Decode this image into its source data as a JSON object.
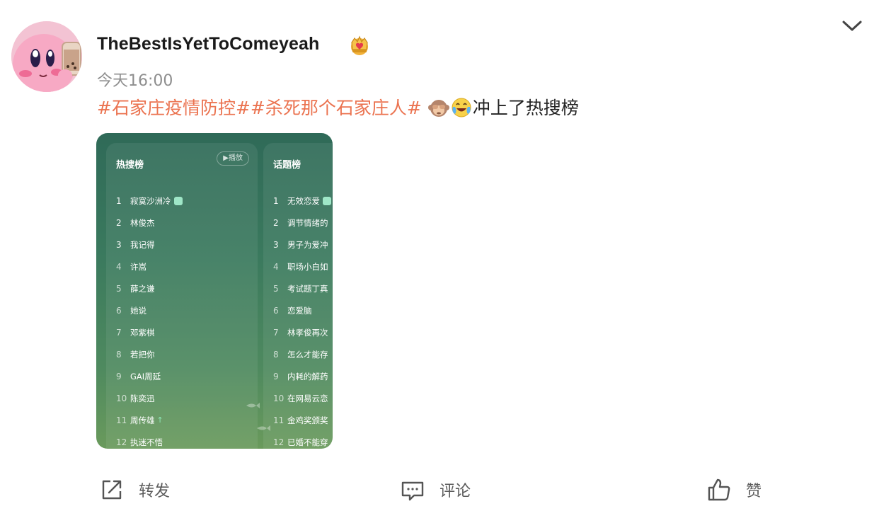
{
  "post": {
    "username": "TheBestIsYetToComeyeah",
    "time": "今天16:00",
    "tag1": "#石家庄疫情防控#",
    "tag2": "#杀死那个石家庄人#",
    "text": "冲上了热搜榜"
  },
  "image": {
    "panel1": {
      "title": "热搜榜",
      "play_label": "▶播放",
      "items": [
        {
          "num": "1",
          "title": "寂寞沙洲冷"
        },
        {
          "num": "2",
          "title": "林俊杰"
        },
        {
          "num": "3",
          "title": "我记得"
        },
        {
          "num": "4",
          "title": "许嵩"
        },
        {
          "num": "5",
          "title": "薛之谦"
        },
        {
          "num": "6",
          "title": "她说"
        },
        {
          "num": "7",
          "title": "邓紫棋"
        },
        {
          "num": "8",
          "title": "若把你"
        },
        {
          "num": "9",
          "title": "GAI周延"
        },
        {
          "num": "10",
          "title": "陈奕迅"
        },
        {
          "num": "11",
          "title": "周传雄"
        },
        {
          "num": "12",
          "title": "执迷不悟"
        }
      ]
    },
    "panel2": {
      "title": "话题榜",
      "items": [
        {
          "num": "1",
          "title": "无效恋爱"
        },
        {
          "num": "2",
          "title": "调节情绪的"
        },
        {
          "num": "3",
          "title": "男子为爱冲"
        },
        {
          "num": "4",
          "title": "职场小白如"
        },
        {
          "num": "5",
          "title": "考试题丁真"
        },
        {
          "num": "6",
          "title": "恋爱脑"
        },
        {
          "num": "7",
          "title": "林孝俊再次"
        },
        {
          "num": "8",
          "title": "怎么才能存"
        },
        {
          "num": "9",
          "title": "内耗的解药"
        },
        {
          "num": "10",
          "title": "在网易云恋"
        },
        {
          "num": "11",
          "title": "金鸡奖颁奖"
        },
        {
          "num": "12",
          "title": "已婚不能穿"
        }
      ]
    }
  },
  "actions": {
    "repost": "转发",
    "comment": "评论",
    "like": "赞"
  },
  "icons": {
    "avatar": "kirby-avatar",
    "crown": "crown-icon",
    "more": "chevron-down-icon",
    "emoji1": "see-no-evil-monkey-emoji",
    "emoji2": "crying-laughing-emoji",
    "repost": "repost-icon",
    "comment": "comment-icon",
    "like": "thumbs-up-icon"
  },
  "colors": {
    "tag": "#eb7350",
    "time": "#8e8e8e",
    "action_text": "#5b5b5b"
  }
}
